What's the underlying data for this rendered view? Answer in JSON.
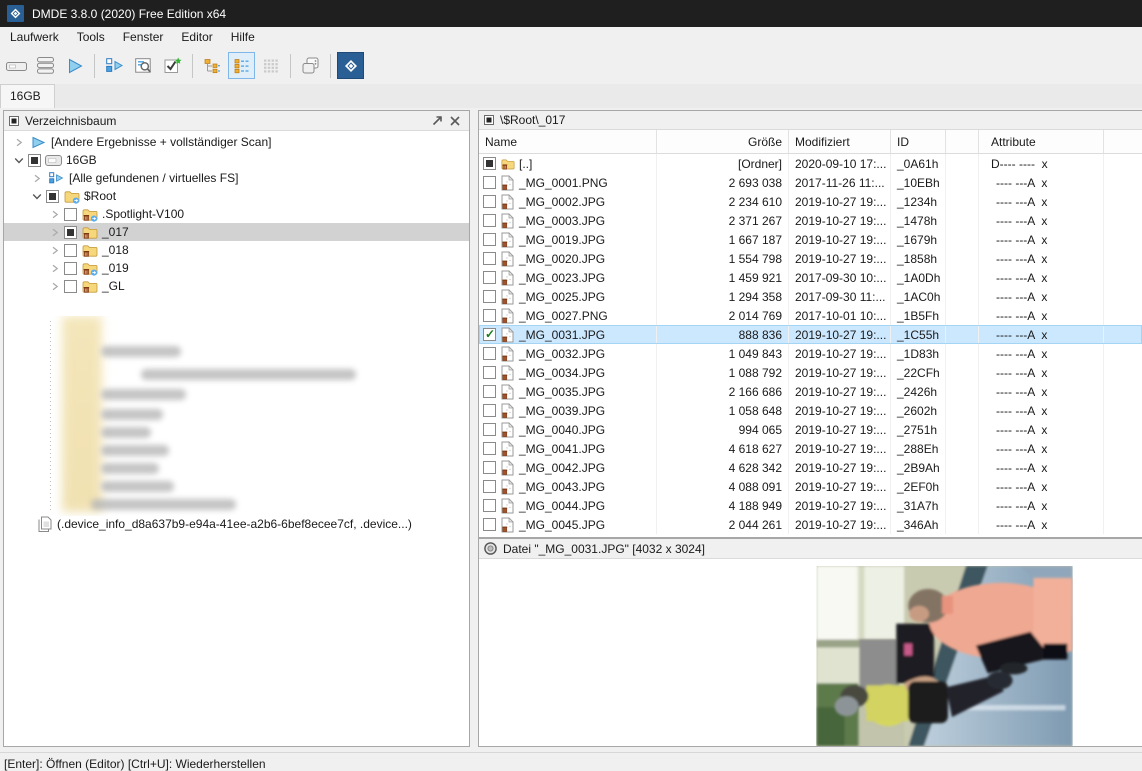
{
  "window": {
    "title": "DMDE 3.8.0 (2020) Free Edition x64"
  },
  "menu": {
    "items": [
      "Laufwerk",
      "Tools",
      "Fenster",
      "Editor",
      "Hilfe"
    ]
  },
  "toolbar": {
    "buttons": [
      {
        "icon": "device-icon"
      },
      {
        "icon": "volumes-icon"
      },
      {
        "icon": "open-play-icon"
      },
      {
        "sep": true
      },
      {
        "icon": "scan-icon"
      },
      {
        "icon": "search-icon"
      },
      {
        "icon": "recover-check-icon"
      },
      {
        "sep": true
      },
      {
        "icon": "tree-view-icon"
      },
      {
        "icon": "list-view-icon",
        "active": true
      },
      {
        "icon": "grid-view-icon",
        "disabled": true
      },
      {
        "sep": true
      },
      {
        "icon": "windows-layout-icon"
      },
      {
        "sep": true
      },
      {
        "icon": "dmde-logo-icon",
        "dark": true
      }
    ]
  },
  "tabs": [
    {
      "label": "16GB",
      "active": true
    }
  ],
  "tree_panel": {
    "title": "Verzeichnisbaum",
    "items": [
      {
        "level": 0,
        "expander": "collapsed",
        "icon": "play-icon",
        "label": "[Andere Ergebnisse + vollständiger Scan]"
      },
      {
        "level": 0,
        "expander": "expanded",
        "checkbox": "filled",
        "icon": "disk-icon",
        "label": "16GB"
      },
      {
        "level": 1,
        "expander": "collapsed",
        "icon": "virtual-fs-icon",
        "label": "[Alle gefundenen / virtuelles FS]"
      },
      {
        "level": 1,
        "expander": "expanded",
        "checkbox": "filled",
        "icon": "folder-open-arrow-icon",
        "label": "$Root"
      },
      {
        "level": 2,
        "expander": "collapsed",
        "checkbox": "empty",
        "icon": "folder-deleted-arrow-icon",
        "label": ".Spotlight-V100"
      },
      {
        "level": 2,
        "expander": "collapsed",
        "checkbox": "filled",
        "icon": "folder-deleted-icon",
        "label": "_017",
        "selected": true
      },
      {
        "level": 2,
        "expander": "collapsed",
        "checkbox": "empty",
        "icon": "folder-deleted-icon",
        "label": "_018"
      },
      {
        "level": 2,
        "expander": "collapsed",
        "checkbox": "empty",
        "icon": "folder-deleted-arrow-icon",
        "label": "_019"
      },
      {
        "level": 2,
        "expander": "collapsed",
        "checkbox": "empty",
        "icon": "folder-deleted-icon",
        "label": "_GL"
      }
    ],
    "footer_item": {
      "icon": "files-icon",
      "label": "(.device_info_d8a637b9-e94a-41ee-a2b6-6bef8ecee7cf, .device...)"
    }
  },
  "file_panel": {
    "path": "\\$Root\\_017",
    "columns": [
      "Name",
      "Größe",
      "Modifiziert",
      "ID",
      "Attribute"
    ],
    "rows": [
      {
        "checkbox": "filled",
        "icon": "folder",
        "name": "[..]",
        "size": "[Ordner]",
        "modified": "2020-09-10 17:...",
        "id": "_0A61h",
        "attr": "D---- ----  x"
      },
      {
        "checkbox": "empty",
        "icon": "file",
        "name": "_MG_0001.PNG",
        "size": "2 693 038",
        "modified": "2017-11-26 11:...",
        "id": "_10EBh",
        "attr": "---- ---A  x"
      },
      {
        "checkbox": "empty",
        "icon": "file",
        "name": "_MG_0002.JPG",
        "size": "2 234 610",
        "modified": "2019-10-27 19:...",
        "id": "_1234h",
        "attr": "---- ---A  x"
      },
      {
        "checkbox": "empty",
        "icon": "file",
        "name": "_MG_0003.JPG",
        "size": "2 371 267",
        "modified": "2019-10-27 19:...",
        "id": "_1478h",
        "attr": "---- ---A  x"
      },
      {
        "checkbox": "empty",
        "icon": "file",
        "name": "_MG_0019.JPG",
        "size": "1 667 187",
        "modified": "2019-10-27 19:...",
        "id": "_1679h",
        "attr": "---- ---A  x"
      },
      {
        "checkbox": "empty",
        "icon": "file",
        "name": "_MG_0020.JPG",
        "size": "1 554 798",
        "modified": "2019-10-27 19:...",
        "id": "_1858h",
        "attr": "---- ---A  x"
      },
      {
        "checkbox": "empty",
        "icon": "file",
        "name": "_MG_0023.JPG",
        "size": "1 459 921",
        "modified": "2017-09-30 10:...",
        "id": "_1A0Dh",
        "attr": "---- ---A  x"
      },
      {
        "checkbox": "empty",
        "icon": "file",
        "name": "_MG_0025.JPG",
        "size": "1 294 358",
        "modified": "2017-09-30 11:...",
        "id": "_1AC0h",
        "attr": "---- ---A  x"
      },
      {
        "checkbox": "empty",
        "icon": "file",
        "name": "_MG_0027.PNG",
        "size": "2 014 769",
        "modified": "2017-10-01 10:...",
        "id": "_1B5Fh",
        "attr": "---- ---A  x"
      },
      {
        "checkbox": "checked",
        "icon": "file",
        "name": "_MG_0031.JPG",
        "size": "888 836",
        "modified": "2019-10-27 19:...",
        "id": "_1C55h",
        "attr": "---- ---A  x",
        "selected": true
      },
      {
        "checkbox": "empty",
        "icon": "file",
        "name": "_MG_0032.JPG",
        "size": "1 049 843",
        "modified": "2019-10-27 19:...",
        "id": "_1D83h",
        "attr": "---- ---A  x"
      },
      {
        "checkbox": "empty",
        "icon": "file",
        "name": "_MG_0034.JPG",
        "size": "1 088 792",
        "modified": "2019-10-27 19:...",
        "id": "_22CFh",
        "attr": "---- ---A  x"
      },
      {
        "checkbox": "empty",
        "icon": "file",
        "name": "_MG_0035.JPG",
        "size": "2 166 686",
        "modified": "2019-10-27 19:...",
        "id": "_2426h",
        "attr": "---- ---A  x"
      },
      {
        "checkbox": "empty",
        "icon": "file",
        "name": "_MG_0039.JPG",
        "size": "1 058 648",
        "modified": "2019-10-27 19:...",
        "id": "_2602h",
        "attr": "---- ---A  x"
      },
      {
        "checkbox": "empty",
        "icon": "file",
        "name": "_MG_0040.JPG",
        "size": "994 065",
        "modified": "2019-10-27 19:...",
        "id": "_2751h",
        "attr": "---- ---A  x"
      },
      {
        "checkbox": "empty",
        "icon": "file",
        "name": "_MG_0041.JPG",
        "size": "4 618 627",
        "modified": "2019-10-27 19:...",
        "id": "_288Eh",
        "attr": "---- ---A  x"
      },
      {
        "checkbox": "empty",
        "icon": "file",
        "name": "_MG_0042.JPG",
        "size": "4 628 342",
        "modified": "2019-10-27 19:...",
        "id": "_2B9Ah",
        "attr": "---- ---A  x"
      },
      {
        "checkbox": "empty",
        "icon": "file",
        "name": "_MG_0043.JPG",
        "size": "4 088 091",
        "modified": "2019-10-27 19:...",
        "id": "_2EF0h",
        "attr": "---- ---A  x"
      },
      {
        "checkbox": "empty",
        "icon": "file",
        "name": "_MG_0044.JPG",
        "size": "4 188 949",
        "modified": "2019-10-27 19:...",
        "id": "_31A7h",
        "attr": "---- ---A  x"
      },
      {
        "checkbox": "empty",
        "icon": "file",
        "name": "_MG_0045.JPG",
        "size": "2 044 261",
        "modified": "2019-10-27 19:...",
        "id": "_346Ah",
        "attr": "---- ---A  x"
      }
    ]
  },
  "preview": {
    "label": "Datei \"_MG_0031.JPG\" [4032 x 3024]"
  },
  "status_bar": {
    "text": "[Enter]: Öffnen (Editor)  [Ctrl+U]: Wiederherstellen"
  },
  "colors": {
    "titlebar": "#1f1f1f",
    "accent_blue": "#2a5f96",
    "file_selection": "#cce8ff",
    "tree_selection": "#d2d2d2",
    "toolbar_active_bg": "#e0eef9",
    "toolbar_active_border": "#7fb8e8"
  }
}
